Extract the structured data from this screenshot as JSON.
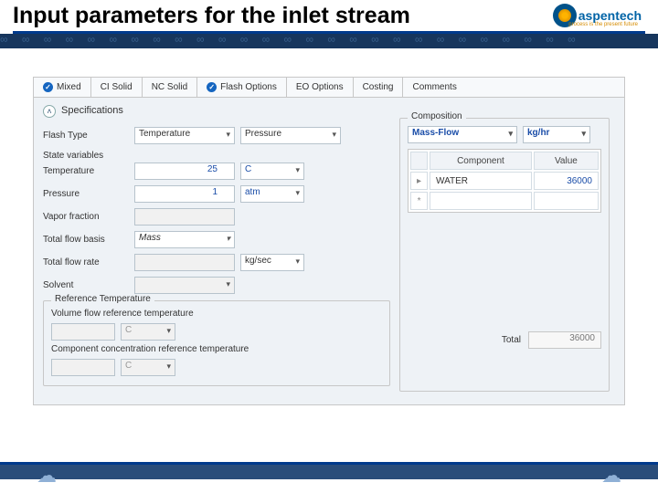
{
  "header": {
    "title": "Input parameters for the inlet stream",
    "logo_text": "aspentech",
    "logo_sub": "process is the present future"
  },
  "tabs": [
    {
      "label": "Mixed",
      "checked": true
    },
    {
      "label": "CI Solid",
      "checked": false
    },
    {
      "label": "NC Solid",
      "checked": false
    },
    {
      "label": "Flash Options",
      "checked": true
    },
    {
      "label": "EO Options",
      "checked": false
    },
    {
      "label": "Costing",
      "checked": false
    },
    {
      "label": "Comments",
      "checked": false
    }
  ],
  "section_title": "Specifications",
  "flash": {
    "label": "Flash Type",
    "type1": "Temperature",
    "type2": "Pressure"
  },
  "state": {
    "heading": "State variables",
    "temperature_label": "Temperature",
    "temperature_value": "25",
    "temperature_unit": "C",
    "pressure_label": "Pressure",
    "pressure_value": "1",
    "pressure_unit": "atm",
    "vapor_label": "Vapor fraction",
    "basis_label": "Total flow basis",
    "basis_value": "Mass",
    "rate_label": "Total flow rate",
    "rate_unit": "kg/sec",
    "solvent_label": "Solvent"
  },
  "ref": {
    "group": "Reference Temperature",
    "vol_label": "Volume flow reference temperature",
    "vol_unit": "C",
    "conc_label": "Component concentration reference temperature",
    "conc_unit": "C"
  },
  "composition": {
    "group": "Composition",
    "basis": "Mass-Flow",
    "unit": "kg/hr",
    "col_component": "Component",
    "col_value": "Value",
    "rows": [
      {
        "component": "WATER",
        "value": "36000"
      }
    ],
    "total_label": "Total",
    "total_value": "36000"
  }
}
